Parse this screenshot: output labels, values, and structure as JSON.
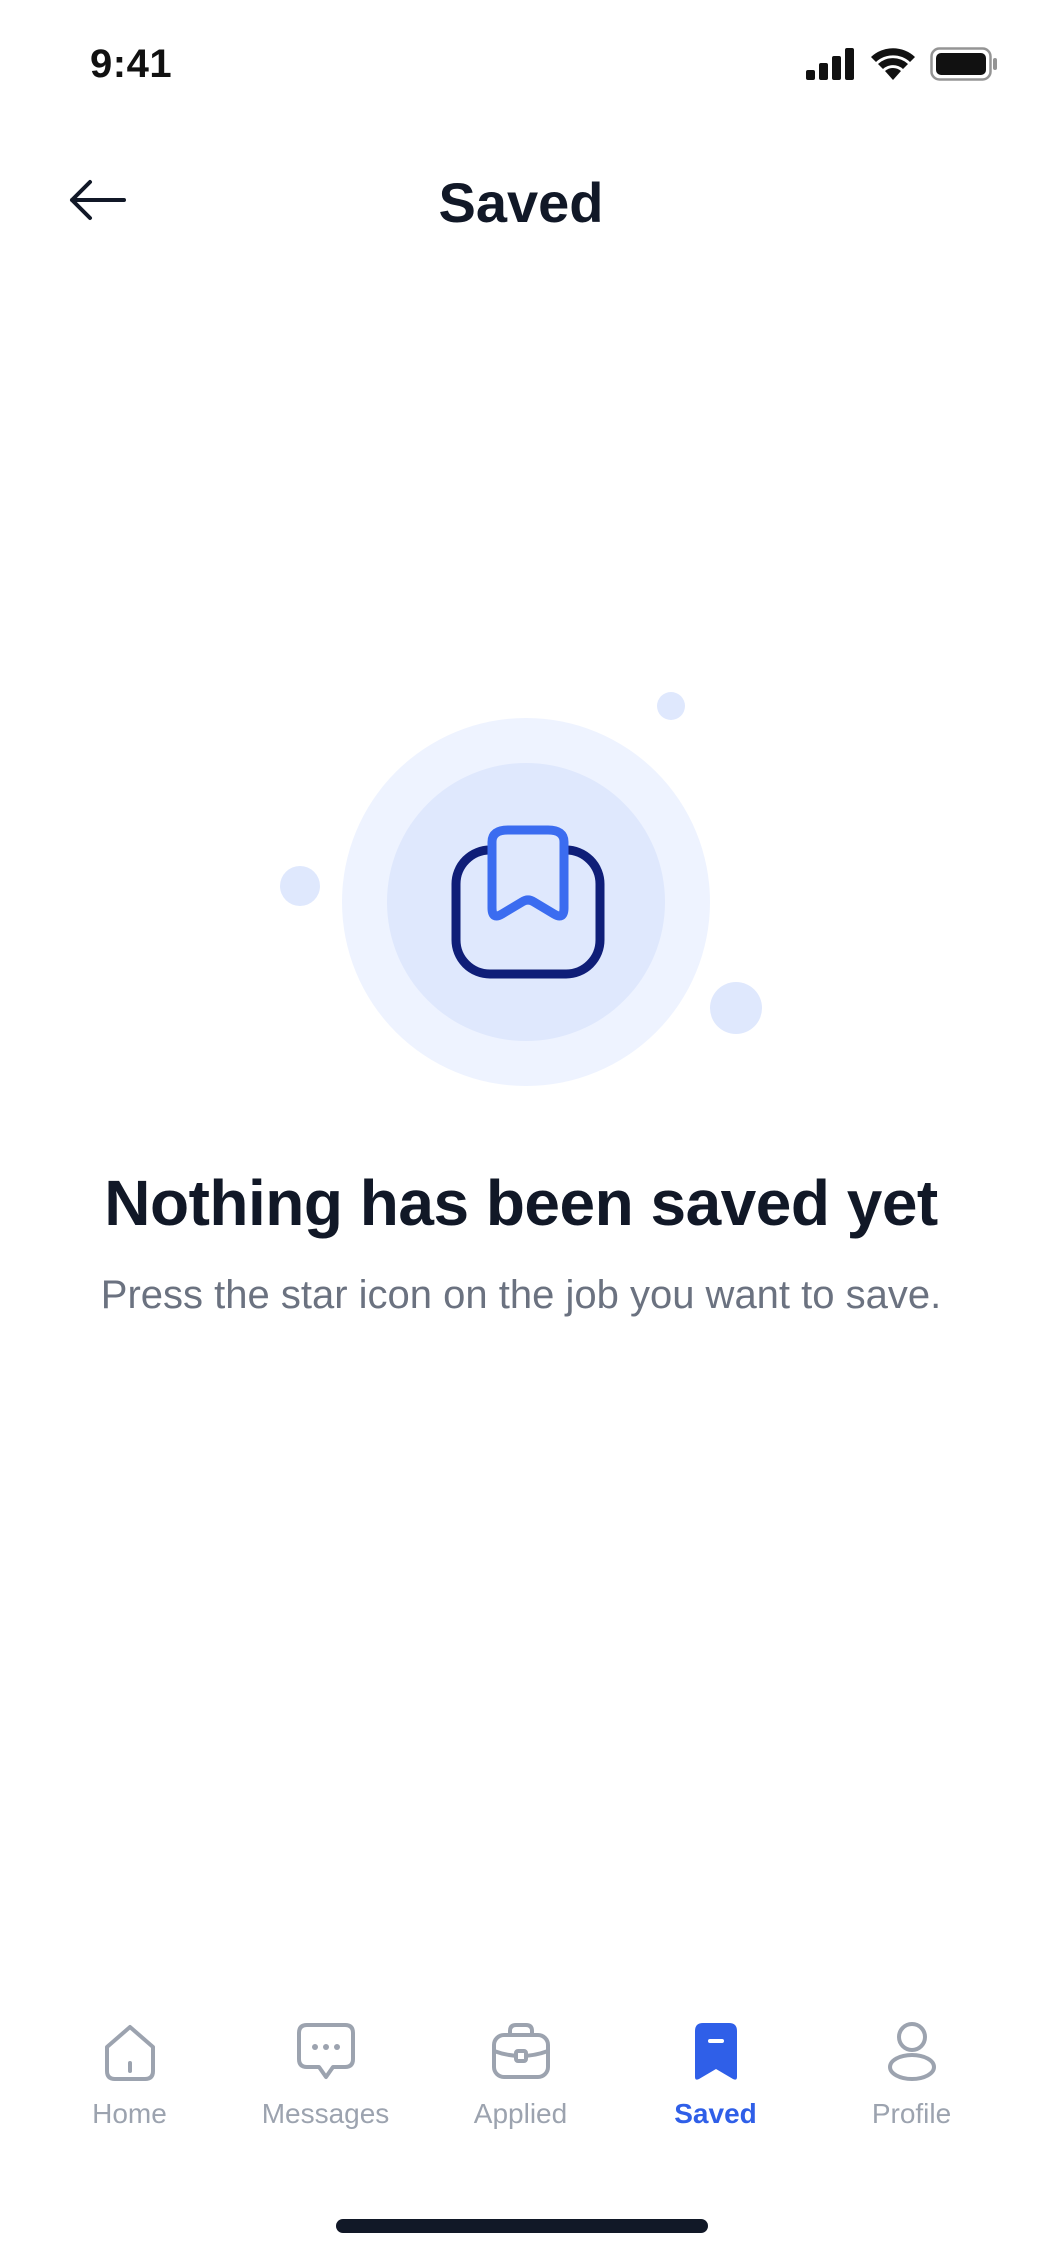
{
  "status_bar": {
    "time": "9:41"
  },
  "header": {
    "title": "Saved",
    "back_icon": "arrow-left-icon"
  },
  "empty_state": {
    "title": "Nothing has been saved yet",
    "subtitle": "Press the star icon on the job you want to save.",
    "illustration_icon": "bookmark-tray-icon"
  },
  "tabs": [
    {
      "label": "Home",
      "icon": "home-icon",
      "active": false
    },
    {
      "label": "Messages",
      "icon": "chat-bubble-icon",
      "active": false
    },
    {
      "label": "Applied",
      "icon": "briefcase-icon",
      "active": false
    },
    {
      "label": "Saved",
      "icon": "bookmark-icon",
      "active": true
    },
    {
      "label": "Profile",
      "icon": "user-icon",
      "active": false
    }
  ],
  "colors": {
    "accent": "#2f5fe8",
    "inactive": "#9ca3af",
    "text": "#111827",
    "subtext": "#6b7280",
    "illustration_light": "#eef3ff",
    "illustration_mid": "#dfe8fd",
    "icon_dark": "#0f1e78",
    "icon_blue": "#3b6cf0"
  }
}
